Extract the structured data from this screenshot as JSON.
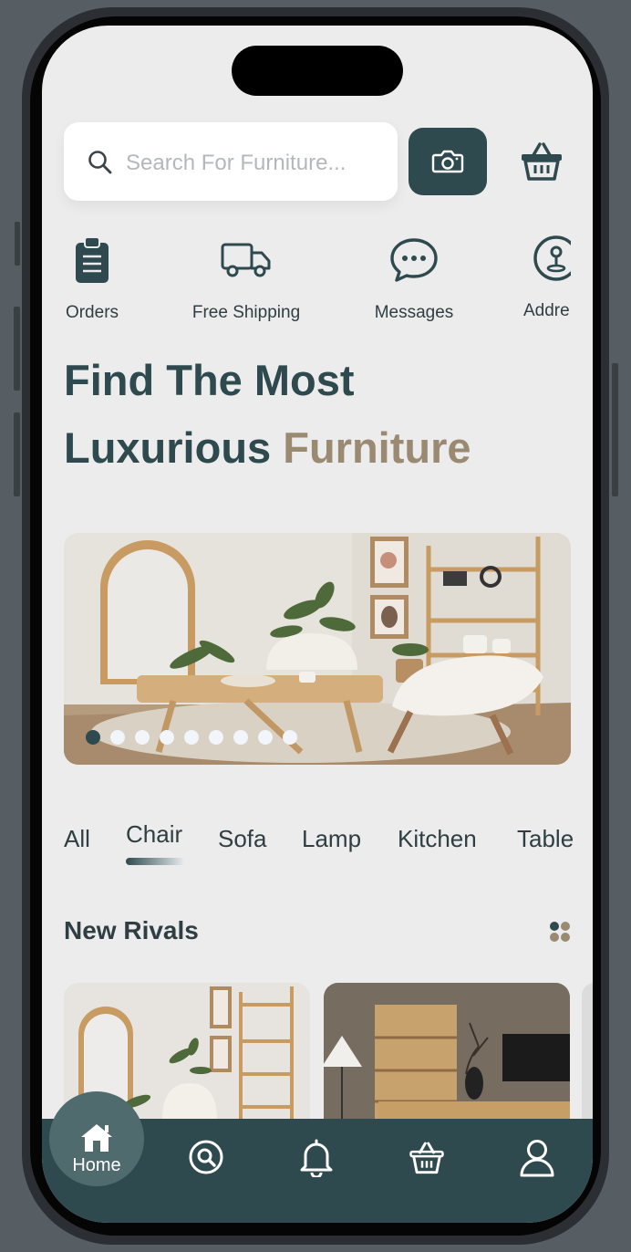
{
  "search": {
    "placeholder": "Search For Furniture...",
    "icon": "search-icon"
  },
  "header_actions": {
    "camera_icon": "camera-icon",
    "basket_icon": "basket-icon"
  },
  "quick_actions": [
    {
      "label": "Orders",
      "icon": "clipboard-icon"
    },
    {
      "label": "Free Shipping",
      "icon": "truck-icon"
    },
    {
      "label": "Messages",
      "icon": "chat-bubble-icon"
    },
    {
      "label": "Addre",
      "icon": "location-pin-icon"
    }
  ],
  "headline": {
    "line1": "Find The Most",
    "line2_main": "Luxurious",
    "line2_accent": "Furniture"
  },
  "banner": {
    "slide_count": 9,
    "active_index": 0
  },
  "categories": [
    {
      "label": "All"
    },
    {
      "label": "Chair",
      "active": true
    },
    {
      "label": "Sofa"
    },
    {
      "label": "Lamp"
    },
    {
      "label": "Kitchen"
    },
    {
      "label": "Table"
    }
  ],
  "section": {
    "title": "New Rivals",
    "view_toggle_icon": "grid-view-icon"
  },
  "tabbar": {
    "active": "Home",
    "items": [
      {
        "label": "Home",
        "icon": "home-icon"
      },
      {
        "icon": "search-icon"
      },
      {
        "icon": "bell-icon"
      },
      {
        "icon": "basket-icon"
      },
      {
        "icon": "user-icon"
      }
    ]
  },
  "colors": {
    "primary": "#2f4a4e",
    "accent": "#9a8a72",
    "background": "#ececec",
    "text": "#2f3e42"
  }
}
